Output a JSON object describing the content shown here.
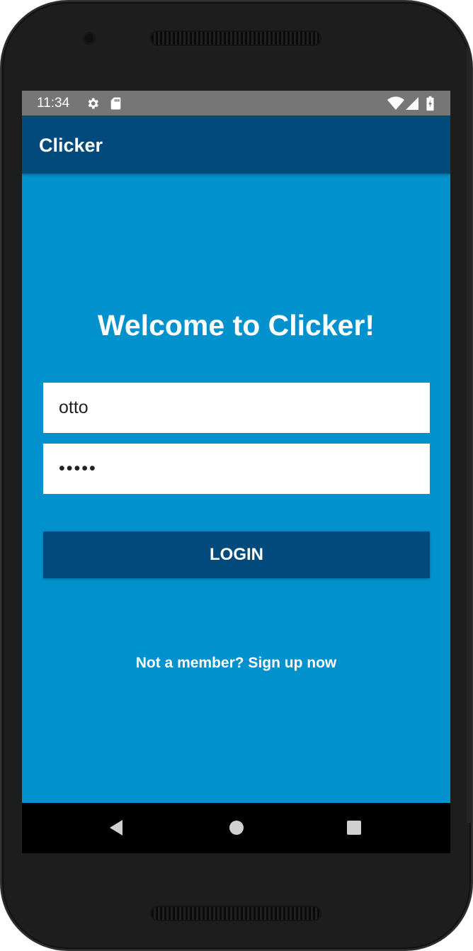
{
  "status_bar": {
    "time": "11:34",
    "icons": [
      "settings-icon",
      "sd-card-icon",
      "wifi-icon",
      "signal-icon",
      "battery-charging-icon"
    ]
  },
  "app_bar": {
    "title": "Clicker",
    "color": "#024a7b"
  },
  "login": {
    "welcome": "Welcome to Clicker!",
    "username_value": "otto",
    "password_value": "•••••",
    "login_label": "LOGIN",
    "signup_text": "Not a member? Sign up now"
  },
  "nav_bar": {
    "buttons": [
      "back-icon",
      "home-icon",
      "recents-icon"
    ]
  },
  "colors": {
    "background": "#0191cd",
    "primary_dark": "#024a7b",
    "status_bar": "#767676",
    "text_on_primary": "#ffffff"
  }
}
